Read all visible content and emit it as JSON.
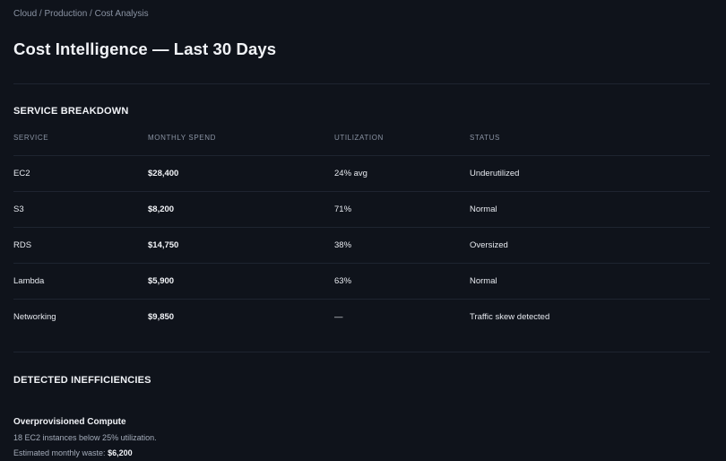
{
  "breadcrumb": "Cloud / Production / Cost Analysis",
  "page_title": "Cost Intelligence — Last 30 Days",
  "breakdown": {
    "title": "SERVICE BREAKDOWN",
    "columns": [
      "SERVICE",
      "MONTHLY SPEND",
      "UTILIZATION",
      "STATUS"
    ],
    "rows": [
      {
        "service": "EC2",
        "spend": "$28,400",
        "utilization": "24% avg",
        "status": "Underutilized"
      },
      {
        "service": "S3",
        "spend": "$8,200",
        "utilization": "71%",
        "status": "Normal"
      },
      {
        "service": "RDS",
        "spend": "$14,750",
        "utilization": "38%",
        "status": "Oversized"
      },
      {
        "service": "Lambda",
        "spend": "$5,900",
        "utilization": "63%",
        "status": "Normal"
      },
      {
        "service": "Networking",
        "spend": "$9,850",
        "utilization": "—",
        "status": "Traffic skew detected"
      }
    ]
  },
  "inefficiencies": {
    "title": "DETECTED INEFFICIENCIES",
    "items": [
      {
        "title": "Overprovisioned Compute",
        "detail": "18 EC2 instances below 25% utilization.",
        "waste_label": "Estimated monthly waste:",
        "waste_value": "$6,200"
      }
    ]
  },
  "colors": {
    "background": "#0f131b",
    "divider": "#1e2430",
    "text": "#e6e9ef",
    "muted": "#8a93a3"
  }
}
